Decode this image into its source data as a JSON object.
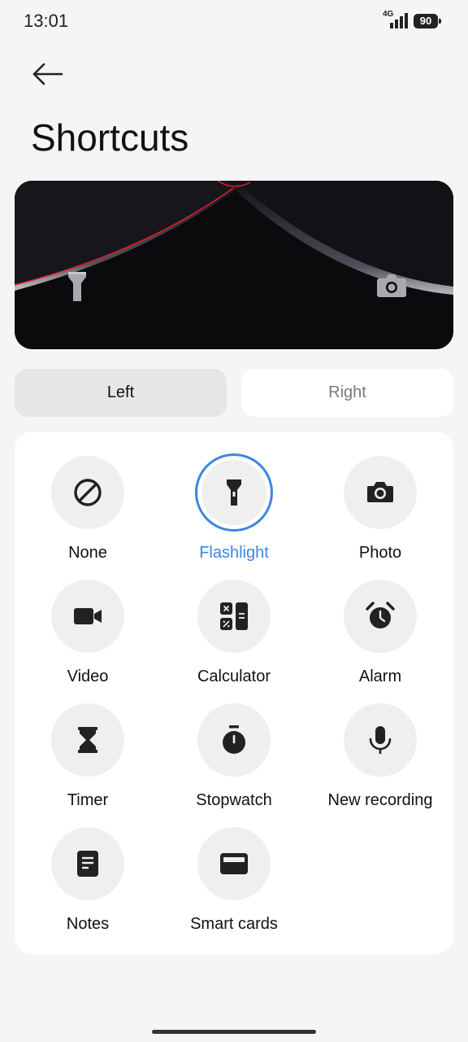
{
  "status_bar": {
    "time": "13:01",
    "network": "4G",
    "battery": "90"
  },
  "header": {
    "back_icon": "arrow-left-icon",
    "title": "Shortcuts"
  },
  "preview": {
    "left_icon": "flashlight-icon",
    "right_icon": "camera-icon"
  },
  "tabs": [
    {
      "label": "Left",
      "selected": true
    },
    {
      "label": "Right",
      "selected": false
    }
  ],
  "options": [
    {
      "label": "None",
      "icon": "none-icon",
      "selected": false
    },
    {
      "label": "Flashlight",
      "icon": "flashlight-icon",
      "selected": true
    },
    {
      "label": "Photo",
      "icon": "camera-icon",
      "selected": false
    },
    {
      "label": "Video",
      "icon": "video-icon",
      "selected": false
    },
    {
      "label": "Calculator",
      "icon": "calculator-icon",
      "selected": false
    },
    {
      "label": "Alarm",
      "icon": "alarm-icon",
      "selected": false
    },
    {
      "label": "Timer",
      "icon": "hourglass-icon",
      "selected": false
    },
    {
      "label": "Stopwatch",
      "icon": "stopwatch-icon",
      "selected": false
    },
    {
      "label": "New recording",
      "icon": "microphone-icon",
      "selected": false
    },
    {
      "label": "Notes",
      "icon": "notes-icon",
      "selected": false
    },
    {
      "label": "Smart cards",
      "icon": "card-icon",
      "selected": false
    }
  ],
  "colors": {
    "accent": "#3b86e0",
    "background": "#f5f5f5",
    "card": "#ffffff",
    "icon_bg": "#efefef"
  }
}
